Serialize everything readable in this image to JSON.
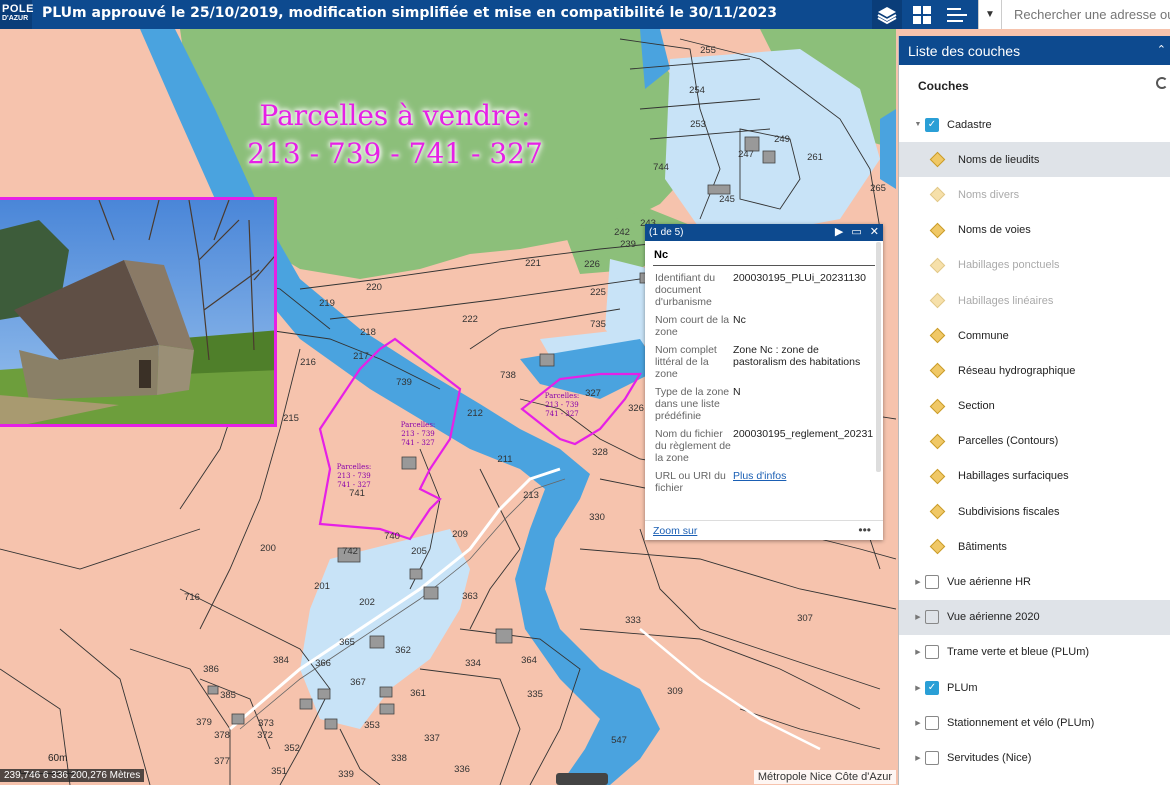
{
  "header": {
    "logo_line1": "POLE",
    "logo_line2": "D'AZUR",
    "title": "PLUm approuvé le 25/10/2019, modification simplifiée et mise en compatibilité le 30/11/2023",
    "search_placeholder": "Rechercher une adresse ou"
  },
  "overlay": {
    "heading_line1": "Parcelles à vendre:",
    "heading_line2": "213 -  739  - 741 - 327",
    "marker_text": "Parcelles:\n213 - 739\n741 - 327"
  },
  "map": {
    "parcel_labels": [
      "255",
      "254",
      "253",
      "249",
      "247",
      "261",
      "265",
      "744",
      "245",
      "243",
      "242",
      "239",
      "226",
      "221",
      "225",
      "735",
      "222",
      "220",
      "219",
      "218",
      "217",
      "216",
      "215",
      "739",
      "212",
      "738",
      "327",
      "326",
      "328",
      "211",
      "213",
      "741",
      "740",
      "209",
      "330",
      "200",
      "205",
      "742",
      "201",
      "202",
      "716",
      "363",
      "365",
      "362",
      "334",
      "333",
      "386",
      "384",
      "366",
      "367",
      "361",
      "335",
      "309",
      "307",
      "385",
      "379",
      "378",
      "373",
      "372",
      "353",
      "352",
      "337",
      "547",
      "377",
      "351",
      "339",
      "338",
      "336",
      "364"
    ],
    "scale_label": "60m",
    "coordinates": "239,746 6 336 200,276 Mètres",
    "attribution": "Métropole Nice Côte d'Azur"
  },
  "popup": {
    "counter": "(1 de 5)",
    "zone": "Nc",
    "fields": [
      {
        "k": "Identifiant du document d'urbanisme",
        "v": "200030195_PLUi_20231130"
      },
      {
        "k": "Nom court de la zone",
        "v": "Nc"
      },
      {
        "k": "Nom complet littéral de la zone",
        "v": "Zone Nc : zone de pastoralism des habitations"
      },
      {
        "k": "Type de la zone dans une liste prédéfinie",
        "v": "N"
      },
      {
        "k": "Nom du fichier du règlement de la zone",
        "v": "200030195_reglement_20231"
      },
      {
        "k": "URL ou URI du fichier",
        "v": "Plus d'infos",
        "link": true
      }
    ],
    "zoom_label": "Zoom sur",
    "more_label": "•••"
  },
  "panel": {
    "title": "Liste des couches",
    "section": "Couches",
    "layers": [
      {
        "label": "Cadastre",
        "type": "group",
        "checked": true,
        "expanded": true
      },
      {
        "label": "Noms de lieudits",
        "type": "sub",
        "selected": true
      },
      {
        "label": "Noms divers",
        "type": "sub",
        "dim": true
      },
      {
        "label": "Noms de voies",
        "type": "sub"
      },
      {
        "label": "Habillages ponctuels",
        "type": "sub",
        "dim": true
      },
      {
        "label": "Habillages linéaires",
        "type": "sub",
        "dim": true
      },
      {
        "label": "Commune",
        "type": "sub"
      },
      {
        "label": "Réseau hydrographique",
        "type": "sub"
      },
      {
        "label": "Section",
        "type": "sub"
      },
      {
        "label": "Parcelles (Contours)",
        "type": "sub"
      },
      {
        "label": "Habillages surfaciques",
        "type": "sub"
      },
      {
        "label": "Subdivisions fiscales",
        "type": "sub"
      },
      {
        "label": "Bâtiments",
        "type": "sub"
      },
      {
        "label": "Vue aérienne HR",
        "type": "group",
        "checked": false
      },
      {
        "label": "Vue aérienne 2020",
        "type": "group",
        "checked": false,
        "selected": true
      },
      {
        "label": "Trame verte et bleue (PLUm)",
        "type": "group",
        "checked": false
      },
      {
        "label": "PLUm",
        "type": "group",
        "checked": true
      },
      {
        "label": "Stationnement et vélo (PLUm)",
        "type": "group",
        "checked": false
      },
      {
        "label": "Servitudes (Nice)",
        "type": "group",
        "checked": false
      }
    ]
  },
  "colors": {
    "header": "#0d4a8f",
    "zone_u": "#f6c3ad",
    "zone_n": "#8cbf7a",
    "zone_water": "#c8e3f7",
    "river": "#4aa3df",
    "highlight": "#e620e6"
  }
}
